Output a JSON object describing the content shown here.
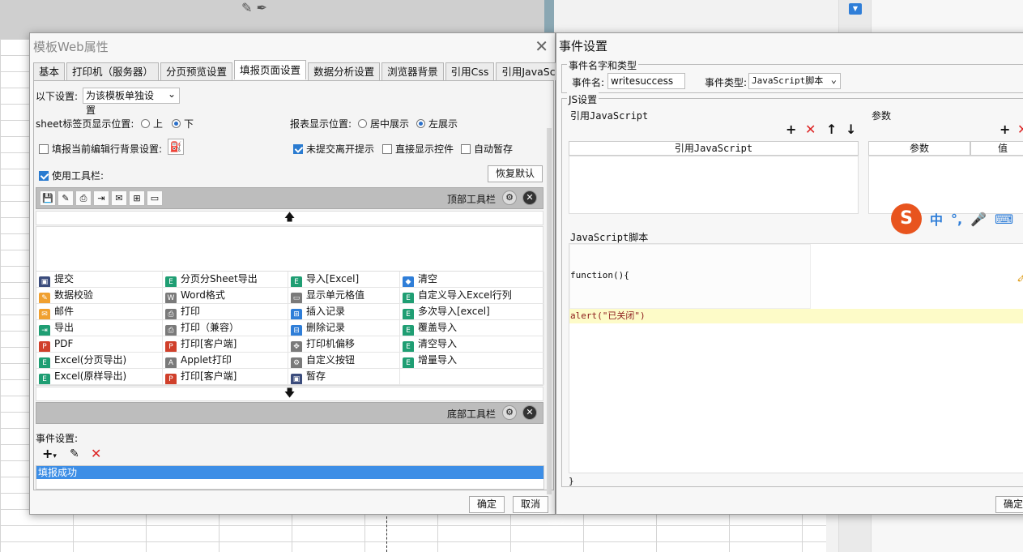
{
  "dialog1": {
    "title": "模板Web属性",
    "tabs": [
      "基本",
      "打印机（服务器）",
      "分页预览设置",
      "填报页面设置",
      "数据分析设置",
      "浏览器背景",
      "引用Css",
      "引用JavaScript"
    ],
    "active_tab": "填报页面设置",
    "settings": {
      "label": "以下设置:",
      "value": "为该模板单独设置",
      "sheet_pos_label": "sheet标签页显示位置:",
      "sheet_up": "上",
      "sheet_down": "下",
      "report_pos_label": "报表显示位置:",
      "report_center": "居中展示",
      "report_left": "左展示",
      "row_bg": "填报当前编辑行背景设置:",
      "unsubmitted": "未提交离开提示",
      "direct_show": "直接显示控件",
      "auto_save": "自动暂存",
      "use_toolbar": "使用工具栏:",
      "restore_default": "恢复默认"
    },
    "top_toolbar_label": "顶部工具栏",
    "bottom_toolbar_label": "底部工具栏",
    "toolbar_items": [
      {
        "icon": "save-icon",
        "label": "提交",
        "color": "navy"
      },
      {
        "icon": "excel-icon",
        "label": "分页分Sheet导出",
        "color": "green"
      },
      {
        "icon": "excel-icon",
        "label": "导入[Excel]",
        "color": "green"
      },
      {
        "icon": "eraser-icon",
        "label": "清空",
        "color": "blue"
      },
      {
        "icon": "pencil-icon",
        "label": "数据校验",
        "color": "orange"
      },
      {
        "icon": "word-icon",
        "label": "Word格式",
        "color": "gray"
      },
      {
        "icon": "cell-icon",
        "label": "显示单元格值",
        "color": "gray"
      },
      {
        "icon": "excel-icon",
        "label": "自定义导入Excel行列",
        "color": "green"
      },
      {
        "icon": "mail-icon",
        "label": "邮件",
        "color": "orange"
      },
      {
        "icon": "printer-icon",
        "label": "打印",
        "color": "gray"
      },
      {
        "icon": "insert-icon",
        "label": "插入记录",
        "color": "blue"
      },
      {
        "icon": "excel-icon",
        "label": "多次导入[excel]",
        "color": "green"
      },
      {
        "icon": "export-icon",
        "label": "导出",
        "color": "green"
      },
      {
        "icon": "printer-icon",
        "label": "打印（兼容）",
        "color": "gray"
      },
      {
        "icon": "delete-row-icon",
        "label": "删除记录",
        "color": "blue"
      },
      {
        "icon": "excel-icon",
        "label": "覆盖导入",
        "color": "green"
      },
      {
        "icon": "pdf-icon",
        "label": "PDF",
        "color": "red"
      },
      {
        "icon": "pdf-icon",
        "label": "打印[客户端]",
        "color": "red"
      },
      {
        "icon": "move-icon",
        "label": "打印机偏移",
        "color": "gray"
      },
      {
        "icon": "excel-icon",
        "label": "清空导入",
        "color": "green"
      },
      {
        "icon": "excel-icon",
        "label": "Excel(分页导出)",
        "color": "green"
      },
      {
        "icon": "applet-icon",
        "label": "Applet打印",
        "color": "gray"
      },
      {
        "icon": "gear-icon",
        "label": "自定义按钮",
        "color": "gray"
      },
      {
        "icon": "excel-icon",
        "label": "增量导入",
        "color": "green"
      },
      {
        "icon": "excel-icon",
        "label": "Excel(原样导出)",
        "color": "green"
      },
      {
        "icon": "pdf-icon",
        "label": "打印[客户端]",
        "color": "red"
      },
      {
        "icon": "save-icon",
        "label": "暂存",
        "color": "navy"
      },
      {
        "icon": "",
        "label": "",
        "color": ""
      }
    ],
    "event_label": "事件设置:",
    "events": [
      "填报成功"
    ],
    "ok": "确定",
    "cancel": "取消"
  },
  "dialog2": {
    "title": "事件设置",
    "name_type_legend": "事件名字和类型",
    "event_name_label": "事件名:",
    "event_name_value": "writesuccess",
    "event_type_label": "事件类型:",
    "event_type_value": "JavaScript脚本",
    "js_legend": "JS设置",
    "ref_js_label": "引用JavaScript",
    "ref_js_header": "引用JavaScript",
    "params_label": "参数",
    "params_header": "参数",
    "params_value_header": "值",
    "script_label": "JavaScript脚本",
    "code_open": "function(){",
    "code_line": "alert(\"已关闭\")",
    "code_close": "}",
    "ok": "确定"
  },
  "ime": {
    "logo": "S",
    "lang": "中",
    "punct": "°,"
  }
}
